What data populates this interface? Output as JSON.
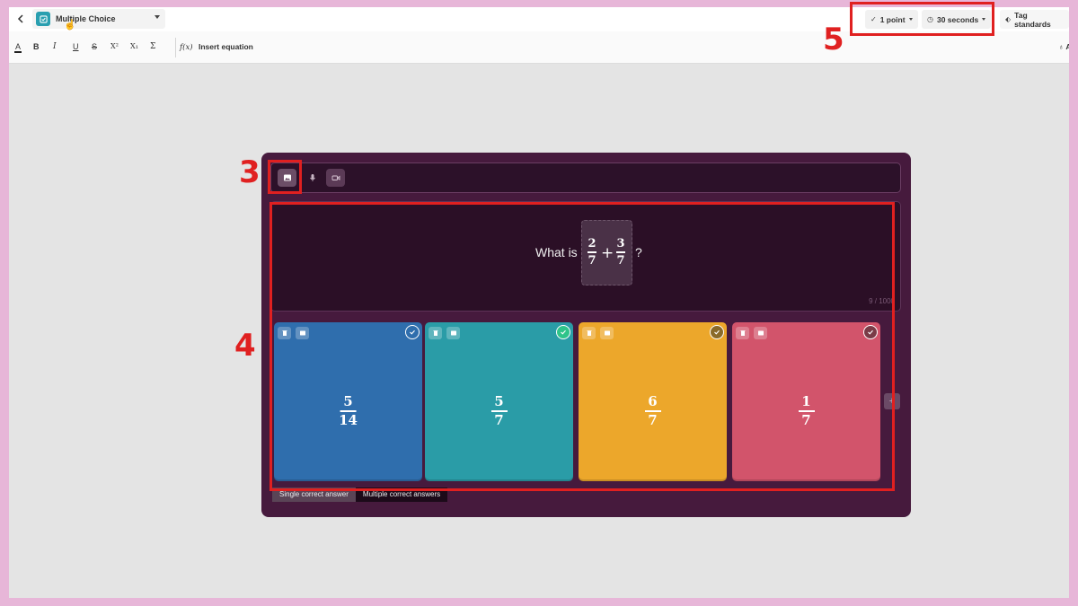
{
  "header": {
    "question_type": "Multiple Choice",
    "points": "1 point",
    "time": "30 seconds",
    "tag_standards": "Tag standards"
  },
  "toolbar": {
    "text_color": "A",
    "bold": "B",
    "italic": "I",
    "underline": "U",
    "strikethrough": "S",
    "superscript": "X²",
    "subscript": "X₁",
    "sigma": "Σ",
    "insert_equation_icon": "f(x)",
    "insert_equation": "Insert equation",
    "truncated_right": "Ac"
  },
  "question": {
    "prefix": "What is",
    "term1": {
      "num": "2",
      "den": "7"
    },
    "operator": "+",
    "term2": {
      "num": "3",
      "den": "7"
    },
    "suffix": "?",
    "char_count": "9 / 1000"
  },
  "answers": [
    {
      "num": "5",
      "den": "14",
      "color": "#2f6ead"
    },
    {
      "num": "5",
      "den": "7",
      "color": "#2a9ca7"
    },
    {
      "num": "6",
      "den": "7",
      "color": "#eca72b"
    },
    {
      "num": "1",
      "den": "7",
      "color": "#d2546b"
    }
  ],
  "answer_mode": {
    "single": "Single correct answer",
    "multiple": "Multiple correct answers"
  },
  "annotations": [
    "3",
    "4",
    "5"
  ],
  "colors": {
    "annotation": "#e02020",
    "editor_bg": "#461a3d"
  }
}
